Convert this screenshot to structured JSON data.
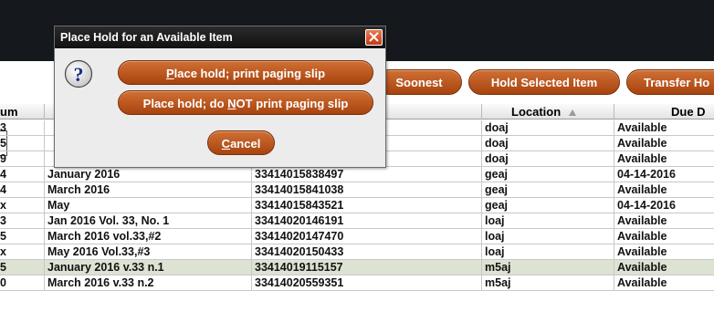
{
  "toolbar": {
    "btn_soonest": "Soonest",
    "btn_hold_selected": "Hold Selected Item",
    "btn_transfer": "Transfer Ho"
  },
  "table": {
    "headers": [
      {
        "label": "um"
      },
      {
        "label": ""
      },
      {
        "label": "ode"
      },
      {
        "label": "Location",
        "sort": "ascending"
      },
      {
        "label": "Due D"
      }
    ],
    "rows": [
      {
        "c0": "3",
        "c1": "",
        "c2": "",
        "c3": "doaj",
        "c4": "Available",
        "selected": false
      },
      {
        "c0": "5",
        "c1": "",
        "c2": "",
        "c3": "doaj",
        "c4": "Available",
        "selected": false
      },
      {
        "c0": "9",
        "c1": "",
        "c2": "",
        "c3": "doaj",
        "c4": "Available",
        "selected": false
      },
      {
        "c0": "4",
        "c1": "January 2016",
        "c2": "33414015838497",
        "c3": "geaj",
        "c4": "04-14-2016",
        "selected": false
      },
      {
        "c0": "4",
        "c1": "March 2016",
        "c2": "33414015841038",
        "c3": "geaj",
        "c4": "Available",
        "selected": false
      },
      {
        "c0": "x",
        "c1": "May",
        "c2": "33414015843521",
        "c3": "geaj",
        "c4": "04-14-2016",
        "selected": false
      },
      {
        "c0": "3",
        "c1": "Jan 2016 Vol. 33, No. 1",
        "c2": "33414020146191",
        "c3": "loaj",
        "c4": "Available",
        "selected": false
      },
      {
        "c0": "5",
        "c1": "March 2016 vol.33,#2",
        "c2": "33414020147470",
        "c3": "loaj",
        "c4": "Available",
        "selected": false
      },
      {
        "c0": "x",
        "c1": "May 2016 Vol.33,#3",
        "c2": "33414020150433",
        "c3": "loaj",
        "c4": "Available",
        "selected": false
      },
      {
        "c0": "5",
        "c1": "January 2016 v.33 n.1",
        "c2": "33414019115157",
        "c3": "m5aj",
        "c4": "Available",
        "selected": true
      },
      {
        "c0": "0",
        "c1": "March 2016 v.33 n.2",
        "c2": "33414020559351",
        "c3": "m5aj",
        "c4": "Available",
        "selected": false
      }
    ]
  },
  "dialog": {
    "title": "Place Hold for an Available Item",
    "icon": "question-icon",
    "btn_print_prefix": "",
    "btn_print_mnemonic": "P",
    "btn_print_rest": "lace hold; print paging slip",
    "btn_noprint_prefix": "Place hold; do ",
    "btn_noprint_mnemonic": "N",
    "btn_noprint_rest": "OT print paging slip",
    "btn_cancel_mnemonic": "C",
    "btn_cancel_rest": "ancel"
  },
  "colors": {
    "accent": "#b4521c",
    "topbar": "#15191d",
    "selected_row": "#dde3d3"
  }
}
